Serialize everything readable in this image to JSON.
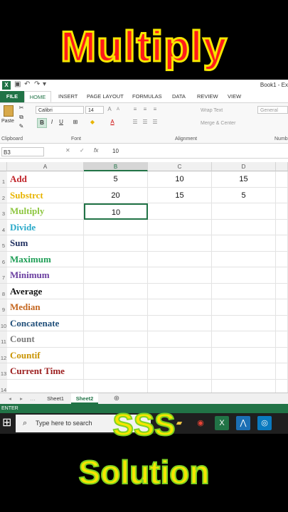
{
  "overlay": {
    "top_title": "Multiply",
    "bottom_line1": "SSS",
    "bottom_line2": "Solution"
  },
  "window": {
    "title": "Book1 - Ex",
    "app_icon": "X"
  },
  "ribbon": {
    "tabs": [
      "FILE",
      "HOME",
      "INSERT",
      "PAGE LAYOUT",
      "FORMULAS",
      "DATA",
      "REVIEW",
      "VIEW"
    ],
    "paste_label": "Paste",
    "font_name": "Calibri",
    "font_size": "14",
    "bold": "B",
    "italic": "I",
    "underline": "U",
    "wrap_text": "Wrap Text",
    "merge_center": "Merge & Center",
    "number_format": "General",
    "groups": {
      "clipboard": "Clipboard",
      "font": "Font",
      "alignment": "Alignment",
      "number": "Numb"
    }
  },
  "formula_bar": {
    "name_box": "B3",
    "fx": "fx",
    "value": "10"
  },
  "columns": [
    "A",
    "B",
    "C",
    "D"
  ],
  "rows": [
    {
      "num": "1",
      "a": "Add",
      "color": "#c0242a",
      "b": "5",
      "c": "10",
      "d": "15"
    },
    {
      "num": "2",
      "a": "Substrct",
      "color": "#e8b400",
      "b": "20",
      "c": "15",
      "d": "5"
    },
    {
      "num": "3",
      "a": "Multiply",
      "color": "#8dc63f",
      "b": "10",
      "c": "",
      "d": ""
    },
    {
      "num": "4",
      "a": "Divide",
      "color": "#29a9c9",
      "b": "",
      "c": "",
      "d": ""
    },
    {
      "num": "5",
      "a": "Sum",
      "color": "#1f2f5f",
      "b": "",
      "c": "",
      "d": ""
    },
    {
      "num": "6",
      "a": "Maximum",
      "color": "#1e9e56",
      "b": "",
      "c": "",
      "d": ""
    },
    {
      "num": "7",
      "a": "Minimum",
      "color": "#6b3fa0",
      "b": "",
      "c": "",
      "d": ""
    },
    {
      "num": "8",
      "a": "Average",
      "color": "#111111",
      "b": "",
      "c": "",
      "d": ""
    },
    {
      "num": "9",
      "a": "Median",
      "color": "#c4661f",
      "b": "",
      "c": "",
      "d": ""
    },
    {
      "num": "10",
      "a": "Concatenate",
      "color": "#1f4e79",
      "b": "",
      "c": "",
      "d": ""
    },
    {
      "num": "11",
      "a": "Count",
      "color": "#7a7a7a",
      "b": "",
      "c": "",
      "d": ""
    },
    {
      "num": "12",
      "a": "Countif",
      "color": "#c99400",
      "b": "",
      "c": "",
      "d": ""
    },
    {
      "num": "13",
      "a": "Current Time",
      "color": "#9b1c1c",
      "b": "",
      "c": "",
      "d": ""
    },
    {
      "num": "14",
      "a": "",
      "color": "#000000",
      "b": "",
      "c": "",
      "d": ""
    }
  ],
  "sheets": [
    "Sheet1",
    "Sheet2"
  ],
  "status": "ENTER",
  "taskbar": {
    "search_placeholder": "Type here to search"
  },
  "colors": {
    "excel_green": "#217346",
    "title_red": "#ff1a1a",
    "overlay_yellow": "#f5e600"
  }
}
